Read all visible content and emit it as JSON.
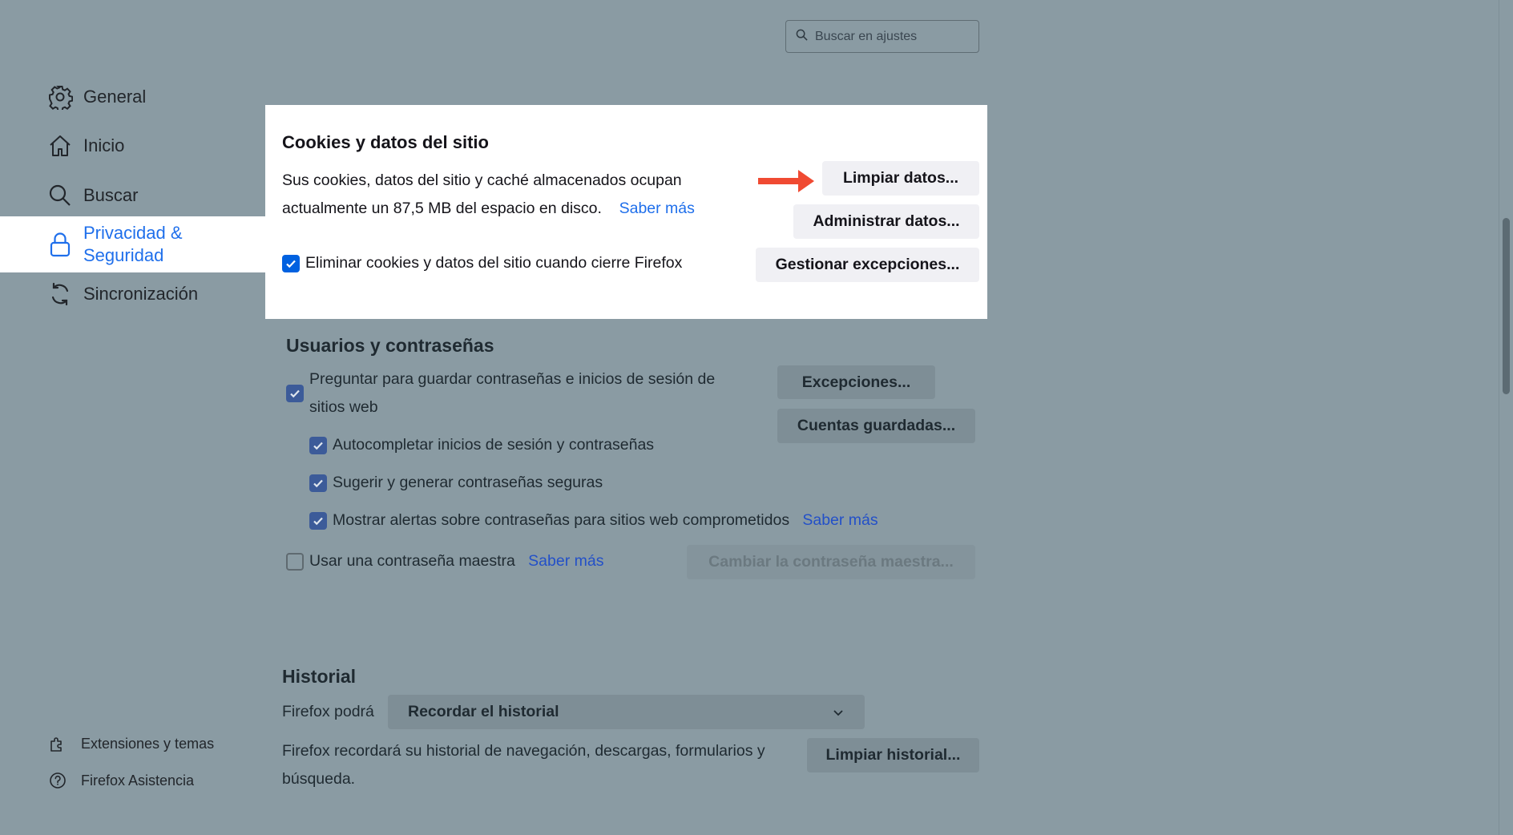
{
  "search": {
    "placeholder": "Buscar en ajustes"
  },
  "sidebar": {
    "items": [
      {
        "label": "General",
        "icon": "gear-icon"
      },
      {
        "label": "Inicio",
        "icon": "home-icon"
      },
      {
        "label": "Buscar",
        "icon": "search-icon"
      },
      {
        "label_line1": "Privacidad &",
        "label_line2": "Seguridad",
        "icon": "lock-icon",
        "selected": true
      },
      {
        "label": "Sincronización",
        "icon": "sync-icon"
      }
    ],
    "footer": [
      {
        "label": "Extensiones y temas",
        "icon": "puzzle-icon"
      },
      {
        "label": "Firefox Asistencia",
        "icon": "help-icon"
      }
    ]
  },
  "cookies": {
    "title": "Cookies y datos del sitio",
    "description": "Sus cookies, datos del sitio y caché almacenados ocupan actualmente un 87,5 MB del espacio en disco.",
    "learn_more": "Saber más",
    "checkbox_label": "Eliminar cookies y datos del sitio cuando cierre Firefox",
    "checkbox_checked": true,
    "clear_button": "Limpiar datos...",
    "manage_button": "Administrar datos...",
    "exceptions_button": "Gestionar excepciones...",
    "arrow_color": "#f04a32"
  },
  "passwords": {
    "title": "Usuarios y contraseñas",
    "ask_save_line1": "Preguntar para guardar contraseñas e inicios de sesión de",
    "ask_save_line2": "sitios web",
    "autofill": "Autocompletar inicios de sesión y contraseñas",
    "suggest": "Sugerir y generar contraseñas seguras",
    "alerts": "Mostrar alertas sobre contraseñas para sitios web comprometidos",
    "alerts_learn_more": "Saber más",
    "master": "Usar una contraseña maestra",
    "master_learn_more": "Saber más",
    "exceptions_button": "Excepciones...",
    "saved_button": "Cuentas guardadas...",
    "change_master_button": "Cambiar la contraseña maestra..."
  },
  "history": {
    "title": "Historial",
    "firefox_will": "Firefox podrá",
    "select_value": "Recordar el historial",
    "description_line1": "Firefox recordará su historial de navegación, descargas, formularios y",
    "description_line2": "búsqueda.",
    "clear_button": "Limpiar historial..."
  },
  "colors": {
    "accent": "#1f6feb",
    "overlay": "#8a9ba3"
  }
}
